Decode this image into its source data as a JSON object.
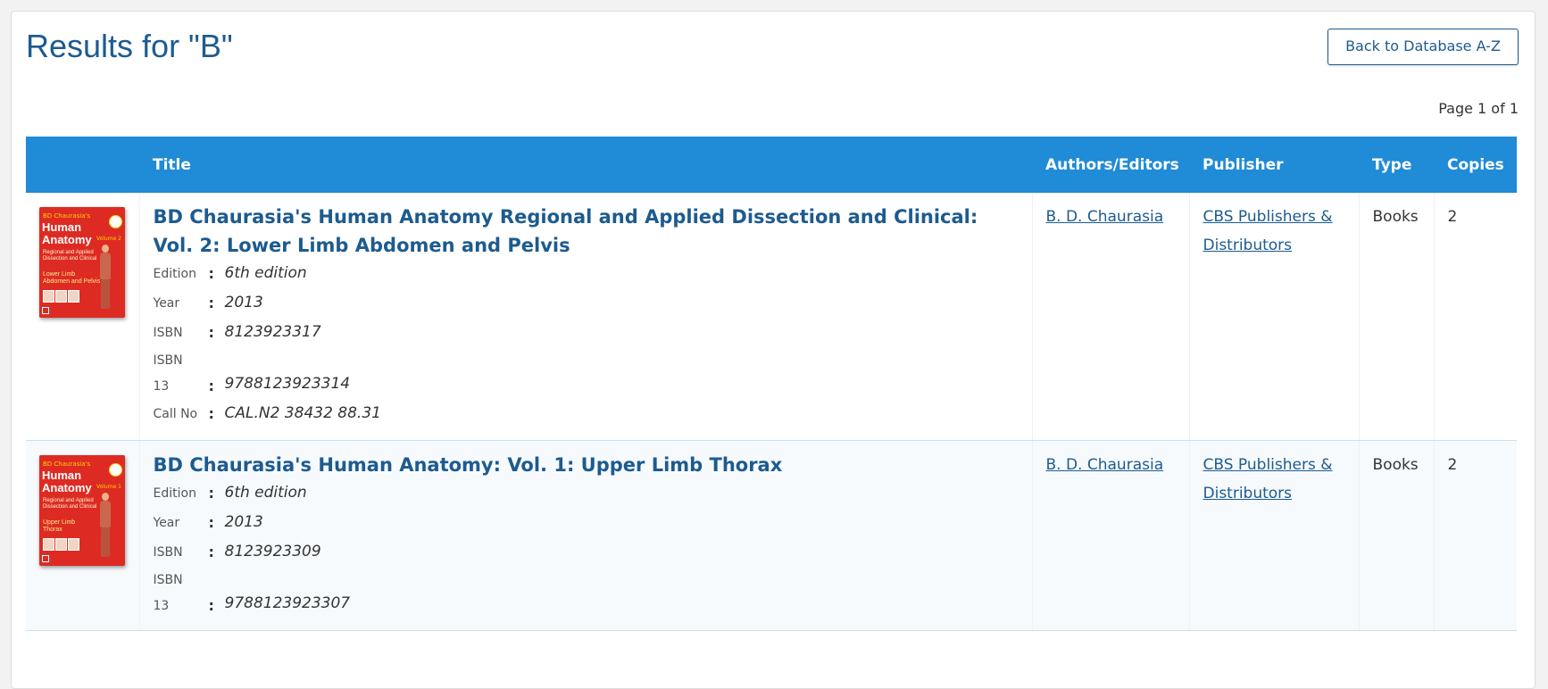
{
  "header": {
    "title": "Results for \"B\"",
    "back_button": "Back to Database A-Z",
    "pagination": "Page 1 of 1"
  },
  "table": {
    "columns": [
      "",
      "Title",
      "Authors/Editors",
      "Publisher",
      "Type",
      "Copies"
    ],
    "rows": [
      {
        "cover": {
          "author": "BD Chaurasia's",
          "title_line1": "Human",
          "title_line2": "Anatomy",
          "volume": "Volume 2",
          "subtitle_line1": "Regional and Applied",
          "subtitle_line2": "Dissection and Clinical",
          "part_line1": "Lower Limb",
          "part_line2": "Abdomen and Pelvis"
        },
        "title": "BD Chaurasia's Human Anatomy Regional and Applied Dissection and Clinical: Vol. 2: Lower Limb Abdomen and Pelvis",
        "meta_labels": {
          "edition": "Edition",
          "year": "Year",
          "isbn": "ISBN",
          "isbn13_a": "ISBN",
          "isbn13_b": "13",
          "callno": "Call No",
          "sep": ":"
        },
        "edition": "6th edition",
        "year": "2013",
        "isbn": "8123923317",
        "isbn13": "9788123923314",
        "call_no": "CAL.N2 38432 88.31",
        "author": "B. D. Chaurasia",
        "publisher": "CBS Publishers & Distributors",
        "type": "Books",
        "copies": "2"
      },
      {
        "cover": {
          "author": "BD Chaurasia's",
          "title_line1": "Human",
          "title_line2": "Anatomy",
          "volume": "Volume 1",
          "subtitle_line1": "Regional and Applied",
          "subtitle_line2": "Dissection and Clinical",
          "part_line1": "Upper Limb",
          "part_line2": "Thorax"
        },
        "title": "BD Chaurasia's Human Anatomy: Vol. 1: Upper Limb Thorax",
        "meta_labels": {
          "edition": "Edition",
          "year": "Year",
          "isbn": "ISBN",
          "isbn13_a": "ISBN",
          "isbn13_b": "13",
          "sep": ":"
        },
        "edition": "6th edition",
        "year": "2013",
        "isbn": "8123923309",
        "isbn13": "9788123923307",
        "author": "B. D. Chaurasia",
        "publisher": "CBS Publishers & Distributors",
        "type": "Books",
        "copies": "2"
      }
    ]
  },
  "colors": {
    "header_blue": "#208bd6",
    "title_blue": "#1d5b8f",
    "cover_red": "#dd2b23"
  }
}
